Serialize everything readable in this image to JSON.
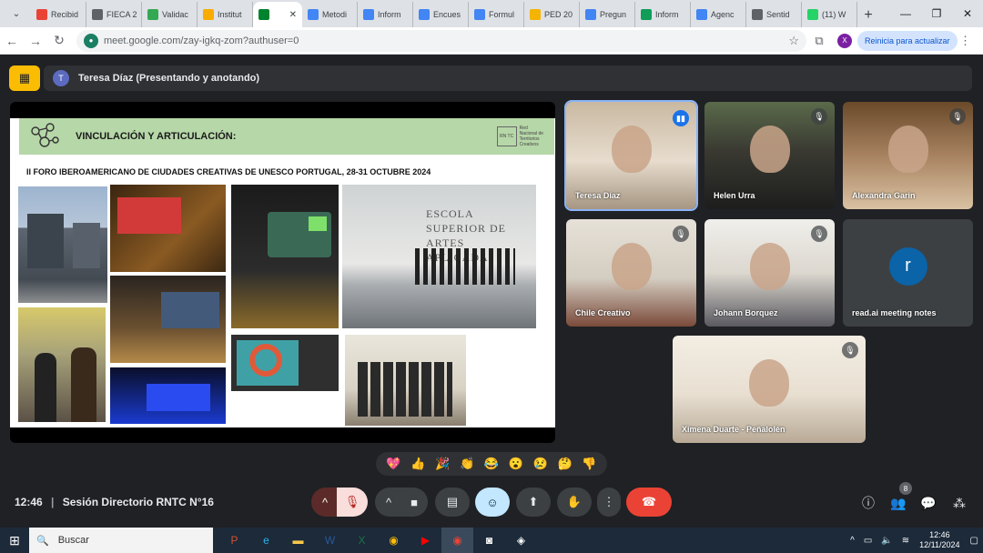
{
  "browser": {
    "tabs": [
      {
        "label": "Recibid",
        "icon": "gmail-icon",
        "color": "#ea4335"
      },
      {
        "label": "FIECA 2",
        "icon": "settings-site-icon",
        "color": "#5f6368"
      },
      {
        "label": "Validac",
        "icon": "drive-icon",
        "color": "#34a853"
      },
      {
        "label": "Institut",
        "icon": "site-icon",
        "color": "#f9ab00"
      },
      {
        "label": "",
        "icon": "meet-icon",
        "color": "#00832d",
        "active": true
      },
      {
        "label": "Metodi",
        "icon": "docs-icon",
        "color": "#4285f4"
      },
      {
        "label": "Inform",
        "icon": "docs-icon",
        "color": "#4285f4"
      },
      {
        "label": "Encues",
        "icon": "docs-icon",
        "color": "#4285f4"
      },
      {
        "label": "Formul",
        "icon": "docs-icon",
        "color": "#4285f4"
      },
      {
        "label": "PED 20",
        "icon": "slides-icon",
        "color": "#f4b400"
      },
      {
        "label": "Pregun",
        "icon": "docs-icon",
        "color": "#4285f4"
      },
      {
        "label": "Inform",
        "icon": "sheets-icon",
        "color": "#0f9d58"
      },
      {
        "label": "Agenc",
        "icon": "site-icon",
        "color": "#4285f4"
      },
      {
        "label": "Sentid",
        "icon": "settings-site-icon",
        "color": "#5f6368"
      },
      {
        "label": "(11) W",
        "icon": "whatsapp-icon",
        "color": "#25d366"
      }
    ],
    "url": "meet.google.com/zay-igkq-zom?authuser=0",
    "profile_initial": "X",
    "restart_label": "Reinicia para actualizar"
  },
  "meet": {
    "presenter": "Teresa Díaz (Presentando y anotando)",
    "presenter_initial": "T",
    "slide": {
      "title": "VINCULACIÓN Y ARTICULACIÓN:",
      "subtitle": "II FORO IBEROAMERICANO DE CIUDADES CREATIVAS DE UNESCO PORTUGAL, 28-31 OCTUBRE 2024",
      "brand_lines": [
        "Red",
        "Nacional de",
        "Territorios",
        "Creativos"
      ],
      "brand_mark": "RN TC",
      "photo_sign": "ESCOLA SUPERIOR DE ARTES APLICADA"
    },
    "participants": [
      {
        "name": "Teresa Díaz",
        "speaking": true
      },
      {
        "name": "Helen Urra",
        "muted": true
      },
      {
        "name": "Alexandra Garin",
        "muted": true
      },
      {
        "name": "Chile Creativo",
        "muted": true
      },
      {
        "name": "Johann Borquez",
        "muted": true
      },
      {
        "name": "read.ai meeting notes",
        "initial": "r"
      },
      {
        "name": "Ximena Duarte - Peñalolén",
        "muted": true
      }
    ],
    "reactions": [
      "💖",
      "👍",
      "🎉",
      "👏",
      "😂",
      "😮",
      "😢",
      "🤔",
      "👎"
    ],
    "time": "12:46",
    "meeting_title": "Sesión Directorio RNTC N°16",
    "participant_count": "8"
  },
  "taskbar": {
    "search_placeholder": "Buscar",
    "time": "12:46",
    "date": "12/11/2024"
  }
}
